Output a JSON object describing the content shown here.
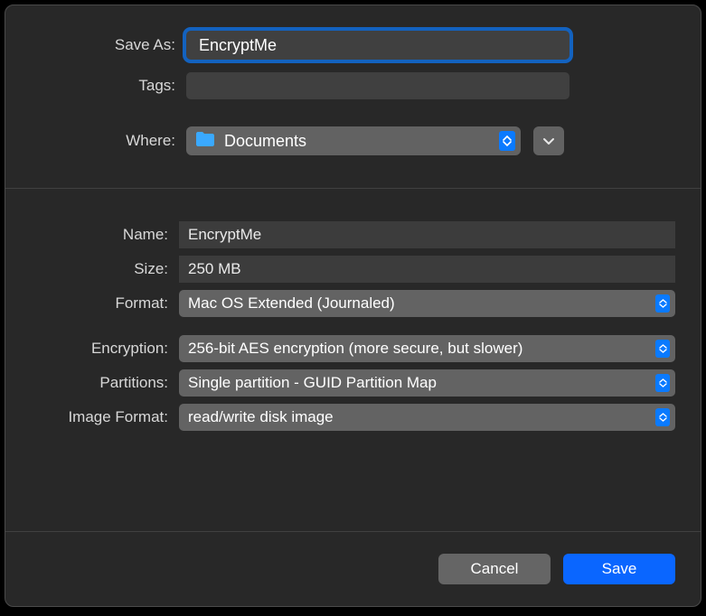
{
  "saveAs": {
    "label": "Save As:",
    "value": "EncryptMe"
  },
  "tags": {
    "label": "Tags:",
    "value": ""
  },
  "where": {
    "label": "Where:",
    "selected": "Documents"
  },
  "name": {
    "label": "Name:",
    "value": "EncryptMe"
  },
  "size": {
    "label": "Size:",
    "value": "250 MB"
  },
  "format": {
    "label": "Format:",
    "selected": "Mac OS Extended (Journaled)"
  },
  "encryption": {
    "label": "Encryption:",
    "selected": "256-bit AES encryption (more secure, but slower)"
  },
  "partitions": {
    "label": "Partitions:",
    "selected": "Single partition - GUID Partition Map"
  },
  "imageFormat": {
    "label": "Image Format:",
    "selected": "read/write disk image"
  },
  "buttons": {
    "cancel": "Cancel",
    "save": "Save"
  }
}
